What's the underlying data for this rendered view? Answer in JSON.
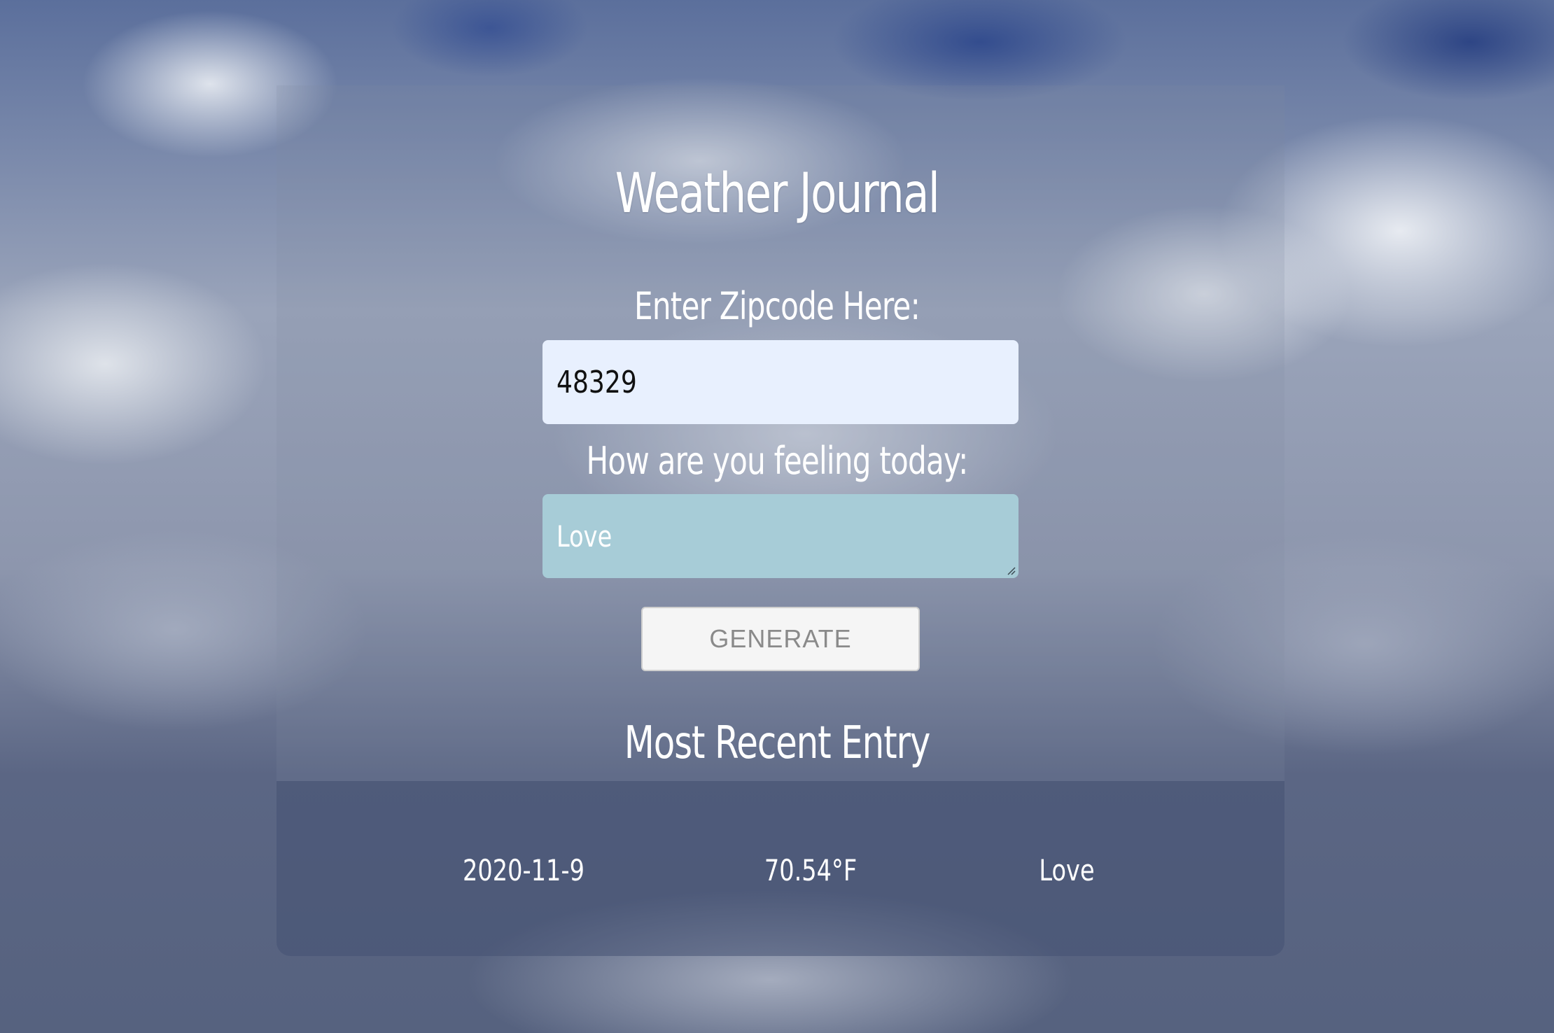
{
  "page": {
    "title": "Weather Journal"
  },
  "form": {
    "zip_label": "Enter Zipcode Here:",
    "zip_value": "48329",
    "feelings_label": "How are you feeling today:",
    "feelings_value": "Love",
    "generate_label": "GENERATE"
  },
  "recent_entry": {
    "title": "Most Recent Entry",
    "date": "2020-11-9",
    "temp": "70.54°F",
    "content": "Love"
  },
  "colors": {
    "zip_input_bg": "#e8f0fe",
    "feelings_input_bg": "#a7ccd7",
    "button_bg": "#f5f5f5",
    "button_text": "#8a8a8a",
    "text": "#ffffff"
  }
}
